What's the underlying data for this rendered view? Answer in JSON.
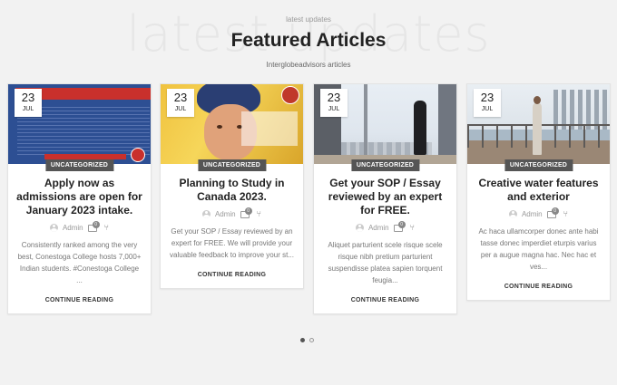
{
  "header": {
    "watermark": "latest updates",
    "eyebrow": "latest updates",
    "title": "Featured Articles",
    "subtitle": "Interglobeadvisors articles"
  },
  "cards": [
    {
      "day": "23",
      "month": "JUL",
      "category": "UNCATEGORIZED",
      "title": "Apply now as admissions are open for January 2023 intake.",
      "author": "Admin",
      "comments": "0",
      "excerpt": "Consistently ranked among the very best, Conestoga College hosts 7,000+ Indian students. #Conestoga College ...",
      "cta": "CONTINUE READING"
    },
    {
      "day": "23",
      "month": "JUL",
      "category": "UNCATEGORIZED",
      "title": "Planning to Study in Canada 2023.",
      "author": "Admin",
      "comments": "0",
      "excerpt": "Get your SOP / Essay reviewed by an expert for FREE. We will provide your valuable feedback to improve your st...",
      "cta": "CONTINUE READING"
    },
    {
      "day": "23",
      "month": "JUL",
      "category": "UNCATEGORIZED",
      "title": "Get your SOP / Essay reviewed by an expert for FREE.",
      "author": "Admin",
      "comments": "0",
      "excerpt": "Aliquet parturient scele risque scele risque nibh pretium parturient suspendisse platea sapien torquent feugia...",
      "cta": "CONTINUE READING"
    },
    {
      "day": "23",
      "month": "JUL",
      "category": "UNCATEGORIZED",
      "title": "Creative water features and exterior",
      "author": "Admin",
      "comments": "0",
      "excerpt": "Ac haca ullamcorper donec ante habi tasse donec imperdiet eturpis varius per a augue magna hac. Nec hac et ves...",
      "cta": "CONTINUE READING"
    }
  ],
  "pagination": {
    "pages": 2,
    "active": 1
  }
}
